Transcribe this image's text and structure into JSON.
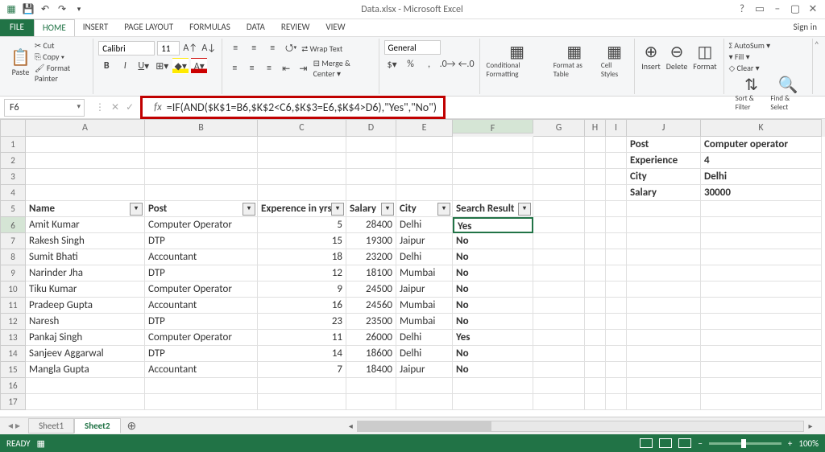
{
  "titlebar": {
    "title": "Data.xlsx - Microsoft Excel",
    "signin": "Sign in"
  },
  "tabs": {
    "file": "FILE",
    "items": [
      "HOME",
      "INSERT",
      "PAGE LAYOUT",
      "FORMULAS",
      "DATA",
      "REVIEW",
      "VIEW"
    ],
    "active": 0
  },
  "ribbon": {
    "paste": "Paste",
    "cut": "Cut",
    "copy": "Copy",
    "format_painter": "Format Painter",
    "font_name": "Calibri",
    "font_size": "11",
    "wrap_text": "Wrap Text",
    "merge_center": "Merge & Center",
    "number_format": "General",
    "conditional": "Conditional Formatting",
    "format_table": "Format as Table",
    "cell_styles": "Cell Styles",
    "insert": "Insert",
    "delete": "Delete",
    "format": "Format",
    "autosum": "AutoSum",
    "fill": "Fill",
    "clear": "Clear",
    "sort": "Sort & Filter",
    "find": "Find & Select"
  },
  "formula_bar": {
    "cell_ref": "F6",
    "fx": "fx",
    "formula": "=IF(AND($K$1=B6,$K$2<C6,$K$3=E6,$K$4>D6),\"Yes\",\"No\")"
  },
  "columns": [
    "A",
    "B",
    "C",
    "D",
    "E",
    "F",
    "G",
    "H",
    "I",
    "J",
    "K"
  ],
  "criteria": [
    {
      "label": "Post",
      "value": "Computer operator"
    },
    {
      "label": "Experience",
      "value": "4"
    },
    {
      "label": "City",
      "value": "Delhi"
    },
    {
      "label": "Salary",
      "value": "30000"
    }
  ],
  "table": {
    "headers": [
      "Name",
      "Post",
      "Experence in yrs",
      "Salary",
      "City",
      "Search Result"
    ],
    "rows": [
      {
        "n": "6",
        "name": "Amit Kumar",
        "post": "Computer Operator",
        "exp": "5",
        "salary": "28400",
        "city": "Delhi",
        "res": "Yes"
      },
      {
        "n": "7",
        "name": "Rakesh Singh",
        "post": "DTP",
        "exp": "15",
        "salary": "19300",
        "city": "Jaipur",
        "res": "No"
      },
      {
        "n": "8",
        "name": "Sumit Bhati",
        "post": "Accountant",
        "exp": "18",
        "salary": "23200",
        "city": "Delhi",
        "res": "No"
      },
      {
        "n": "9",
        "name": "Narinder Jha",
        "post": "DTP",
        "exp": "12",
        "salary": "18100",
        "city": "Mumbai",
        "res": "No"
      },
      {
        "n": "10",
        "name": "Tiku Kumar",
        "post": "Computer Operator",
        "exp": "9",
        "salary": "24500",
        "city": "Jaipur",
        "res": "No"
      },
      {
        "n": "11",
        "name": "Pradeep Gupta",
        "post": "Accountant",
        "exp": "16",
        "salary": "24560",
        "city": "Mumbai",
        "res": "No"
      },
      {
        "n": "12",
        "name": "Naresh",
        "post": "DTP",
        "exp": "23",
        "salary": "23500",
        "city": "Mumbai",
        "res": "No"
      },
      {
        "n": "13",
        "name": "Pankaj Singh",
        "post": "Computer Operator",
        "exp": "11",
        "salary": "26000",
        "city": "Delhi",
        "res": "Yes"
      },
      {
        "n": "14",
        "name": "Sanjeev Aggarwal",
        "post": "DTP",
        "exp": "14",
        "salary": "18600",
        "city": "Delhi",
        "res": "No"
      },
      {
        "n": "15",
        "name": "Mangla Gupta",
        "post": "Accountant",
        "exp": "7",
        "salary": "18400",
        "city": "Jaipur",
        "res": "No"
      }
    ]
  },
  "sheets": {
    "items": [
      "Sheet1",
      "Sheet2"
    ],
    "active": 1
  },
  "status": {
    "ready": "READY",
    "zoom": "100%"
  }
}
